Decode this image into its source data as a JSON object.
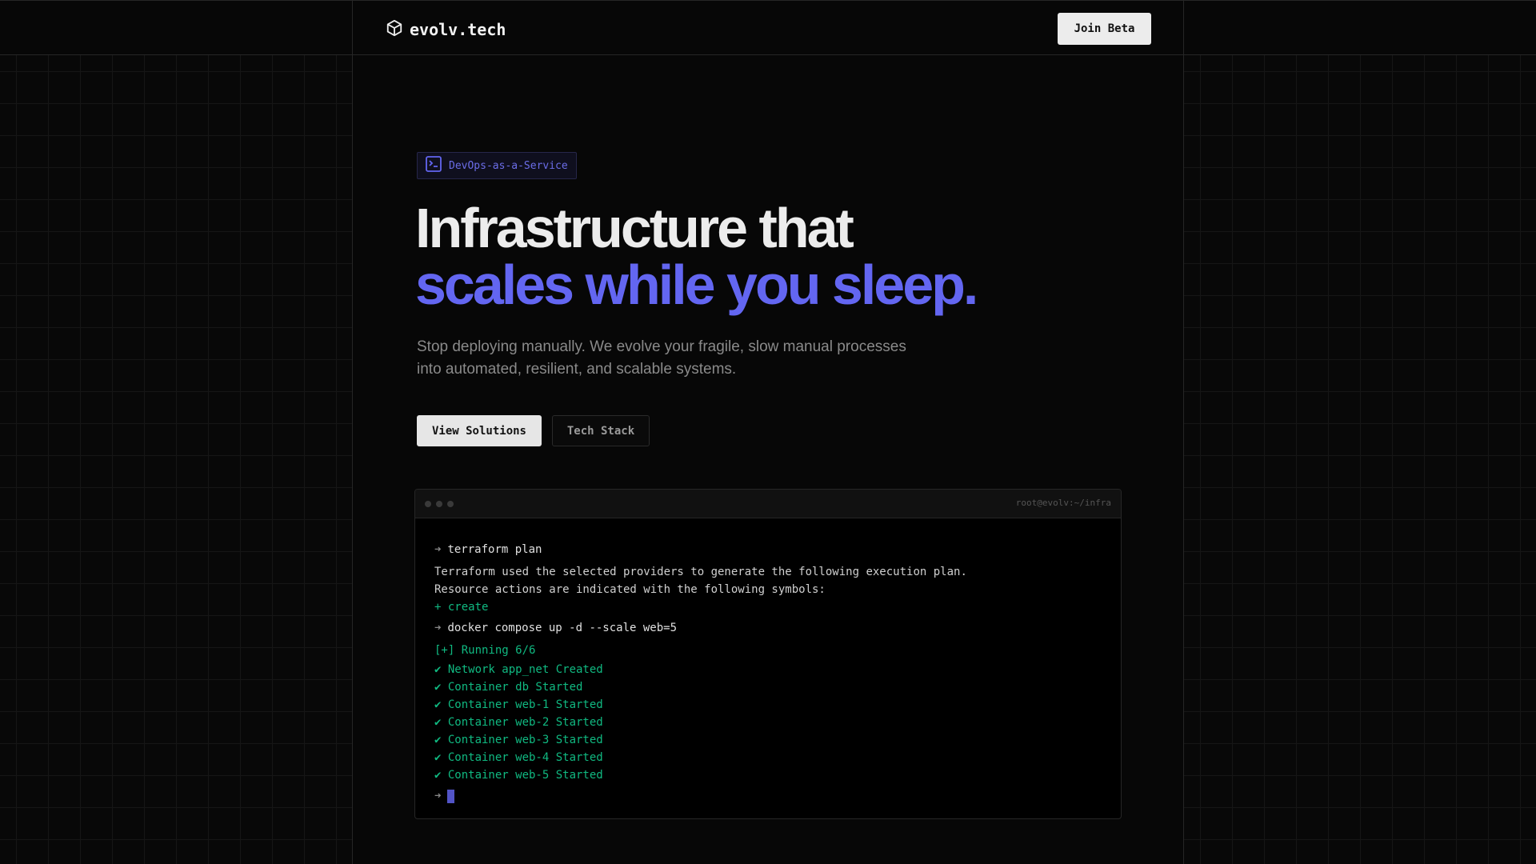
{
  "header": {
    "brand": "evolv.tech",
    "join_label": "Join Beta"
  },
  "hero": {
    "badge": "DevOps-as-a-Service",
    "title_line1": "Infrastructure that",
    "title_line2": "scales while you sleep.",
    "subtitle": "Stop deploying manually. We evolve your fragile, slow manual processes into automated, resilient, and scalable systems.",
    "primary_cta": "View Solutions",
    "secondary_cta": "Tech Stack"
  },
  "terminal": {
    "path": "root@evolv:~/infra",
    "prompt": "➜",
    "cmd1": "terraform plan",
    "out1": "Terraform used the selected providers to generate the following execution plan.",
    "out2": "Resource actions are indicated with the following symbols:",
    "out3": "+ create",
    "cmd2": "docker compose up -d --scale web=5",
    "running": "[+] Running 6/6",
    "lines": [
      "✔ Network app_net Created",
      "✔ Container db Started",
      "✔ Container web-1 Started",
      "✔ Container web-2 Started",
      "✔ Container web-3 Started",
      "✔ Container web-4 Started",
      "✔ Container web-5 Started"
    ]
  },
  "colors": {
    "accent": "#6366f1",
    "success": "#10b981"
  }
}
